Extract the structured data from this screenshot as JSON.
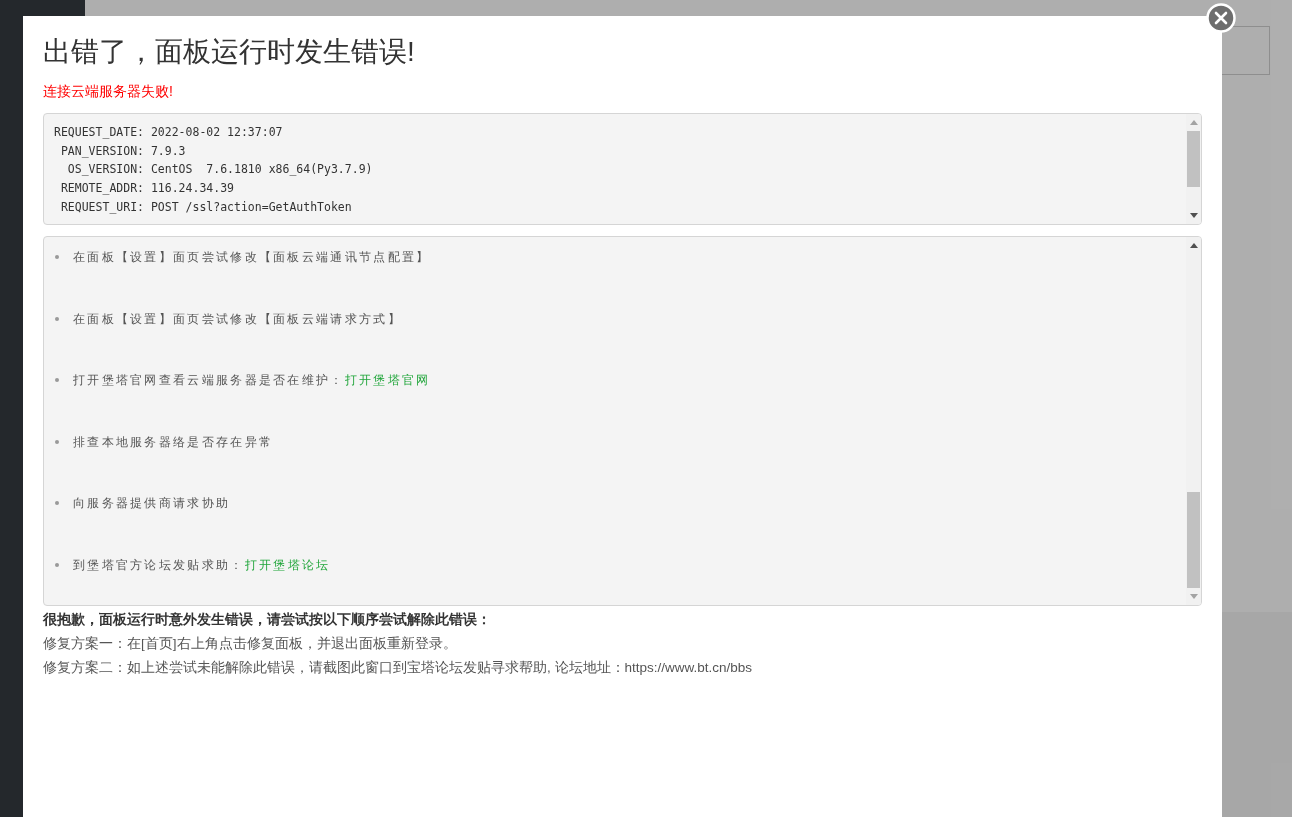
{
  "dialog": {
    "title": "出错了，面板运行时发生错误!",
    "error": "连接云端服务器失败!",
    "request_details": [
      "REQUEST_DATE: 2022-08-02 12:37:07",
      " PAN_VERSION: 7.9.3",
      "  OS_VERSION: CentOS  7.6.1810 x86_64(Py3.7.9)",
      " REMOTE_ADDR: 116.24.34.39",
      " REQUEST_URI: POST /ssl?action=GetAuthToken"
    ],
    "suggestions": [
      {
        "text": "在面板【设置】面页尝试修改【面板云端通讯节点配置】"
      },
      {
        "text": "在面板【设置】面页尝试修改【面板云端请求方式】"
      },
      {
        "text": "打开堡塔官网查看云端服务器是否在维护：",
        "link": "打开堡塔官网"
      },
      {
        "text": "排查本地服务器络是否存在异常"
      },
      {
        "text": "向服务器提供商请求协助"
      },
      {
        "text": "到堡塔官方论坛发贴求助：",
        "link": "打开堡塔论坛"
      }
    ],
    "apology": "很抱歉，面板运行时意外发生错误，请尝试按以下顺序尝试解除此错误：",
    "fixes": [
      "修复方案一：在[首页]右上角点击修复面板，并退出面板重新登录。",
      "修复方案二：如上述尝试未能解除此错误，请截图此窗口到宝塔论坛发贴寻求帮助, 论坛地址：https://www.bt.cn/bbs"
    ]
  }
}
